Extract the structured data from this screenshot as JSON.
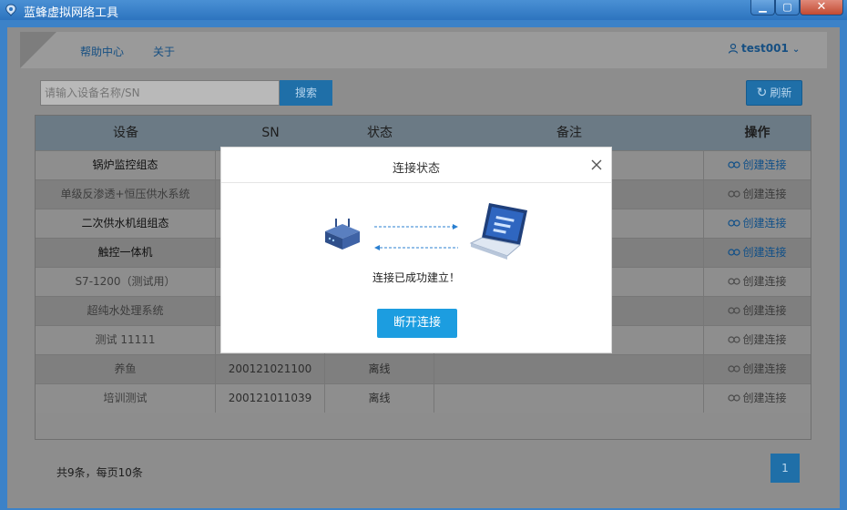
{
  "window": {
    "title": "蓝蜂虚拟网络工具",
    "min": "▁",
    "max": "▢",
    "close": "✕"
  },
  "nav": {
    "help": "帮助中心",
    "about": "关于"
  },
  "user": {
    "name": "test001",
    "chevron": "⌄"
  },
  "search": {
    "placeholder": "请输入设备名称/SN",
    "button": "搜索"
  },
  "refresh": {
    "label": "刷新",
    "icon": "↻"
  },
  "table": {
    "headers": {
      "device": "设备",
      "sn": "SN",
      "status": "状态",
      "remark": "备注",
      "op": "操作"
    },
    "rows": [
      {
        "device": "锅炉监控组态",
        "sn": "",
        "status": "",
        "remark": "",
        "op": "创建连接",
        "active": true
      },
      {
        "device": "单级反渗透+恒压供水系统",
        "sn": "",
        "status": "",
        "remark": "",
        "op": "创建连接",
        "active": false
      },
      {
        "device": "二次供水机组组态",
        "sn": "",
        "status": "",
        "remark": "",
        "op": "创建连接",
        "active": true
      },
      {
        "device": "触控一体机",
        "sn": "",
        "status": "",
        "remark": "",
        "op": "创建连接",
        "active": true
      },
      {
        "device": "S7-1200（测试用）",
        "sn": "",
        "status": "",
        "remark": "",
        "op": "创建连接",
        "active": false
      },
      {
        "device": "超纯水处理系统",
        "sn": "",
        "status": "",
        "remark": "",
        "op": "创建连接",
        "active": false
      },
      {
        "device": "测试 11111",
        "sn": "",
        "status": "",
        "remark": "",
        "op": "创建连接",
        "active": false
      },
      {
        "device": "养鱼",
        "sn": "200121021100",
        "status": "离线",
        "remark": "",
        "op": "创建连接",
        "active": false
      },
      {
        "device": "培训测试",
        "sn": "200121011039",
        "status": "离线",
        "remark": "",
        "op": "创建连接",
        "active": false
      }
    ]
  },
  "pager": {
    "summary": "共9条，每页10条",
    "current": "1"
  },
  "dialog": {
    "title": "连接状态",
    "message": "连接已成功建立！",
    "button": "断开连接"
  },
  "colors": {
    "accent": "#1c9de0",
    "titlebar": "#2d74bf",
    "link": "#0f4f88"
  }
}
